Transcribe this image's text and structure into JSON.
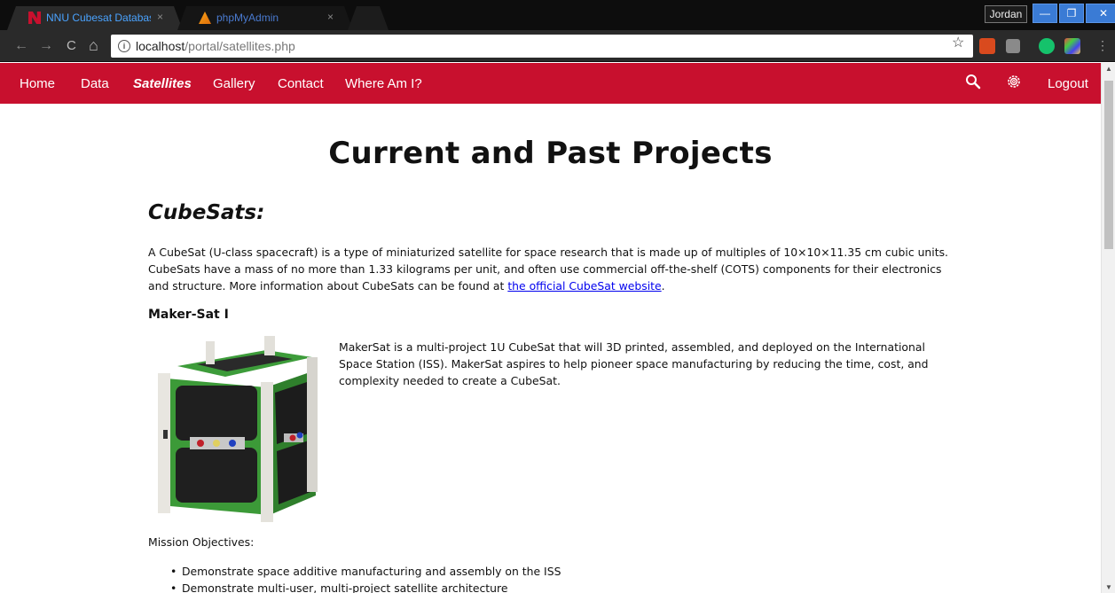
{
  "browser": {
    "tabs": [
      {
        "title": "NNU Cubesat Database",
        "close": "×"
      },
      {
        "title": "phpMyAdmin",
        "close": "×"
      }
    ],
    "user": "Jordan",
    "window_buttons": {
      "minimize": "—",
      "maximize": "❐",
      "close": "✕"
    },
    "nav": {
      "back": "←",
      "forward": "→",
      "reload": "C",
      "home": "⌂"
    },
    "url": {
      "info_glyph": "i",
      "host": "localhost",
      "path": "/portal/satellites.php"
    },
    "star": "☆",
    "menu": "⋮"
  },
  "site_nav": {
    "links": [
      "Home",
      "Data",
      "Satellites",
      "Gallery",
      "Contact",
      "Where Am I?"
    ],
    "active": "Satellites",
    "logout": "Logout"
  },
  "page": {
    "title": "Current and Past Projects",
    "section_title": "CubeSats:",
    "intro_text": "A CubeSat (U-class spacecraft) is a type of miniaturized satellite for space research that is made up of multiples of 10×10×11.35 cm cubic units. CubeSats have a mass of no more than 1.33 kilograms per unit, and often use commercial off-the-shelf (COTS) components for their electronics and structure. More information about CubeSats can be found at ",
    "intro_link": "the official CubeSat website",
    "intro_end": ".",
    "satellite": {
      "name": "Maker-Sat I",
      "description": "MakerSat is a multi-project 1U CubeSat that will 3D printed, assembled, and deployed on the International Space Station (ISS). MakerSat aspires to help pioneer space manufacturing by reducing the time, cost, and complexity needed to create a CubeSat.",
      "objectives_label": "Mission Objectives:",
      "objectives": [
        "Demonstrate space additive manufacturing and assembly on the ISS",
        "Demonstrate multi-user, multi-project satellite architecture"
      ]
    }
  },
  "colors": {
    "brand_red": "#c8102e",
    "link": "#0000ee"
  }
}
